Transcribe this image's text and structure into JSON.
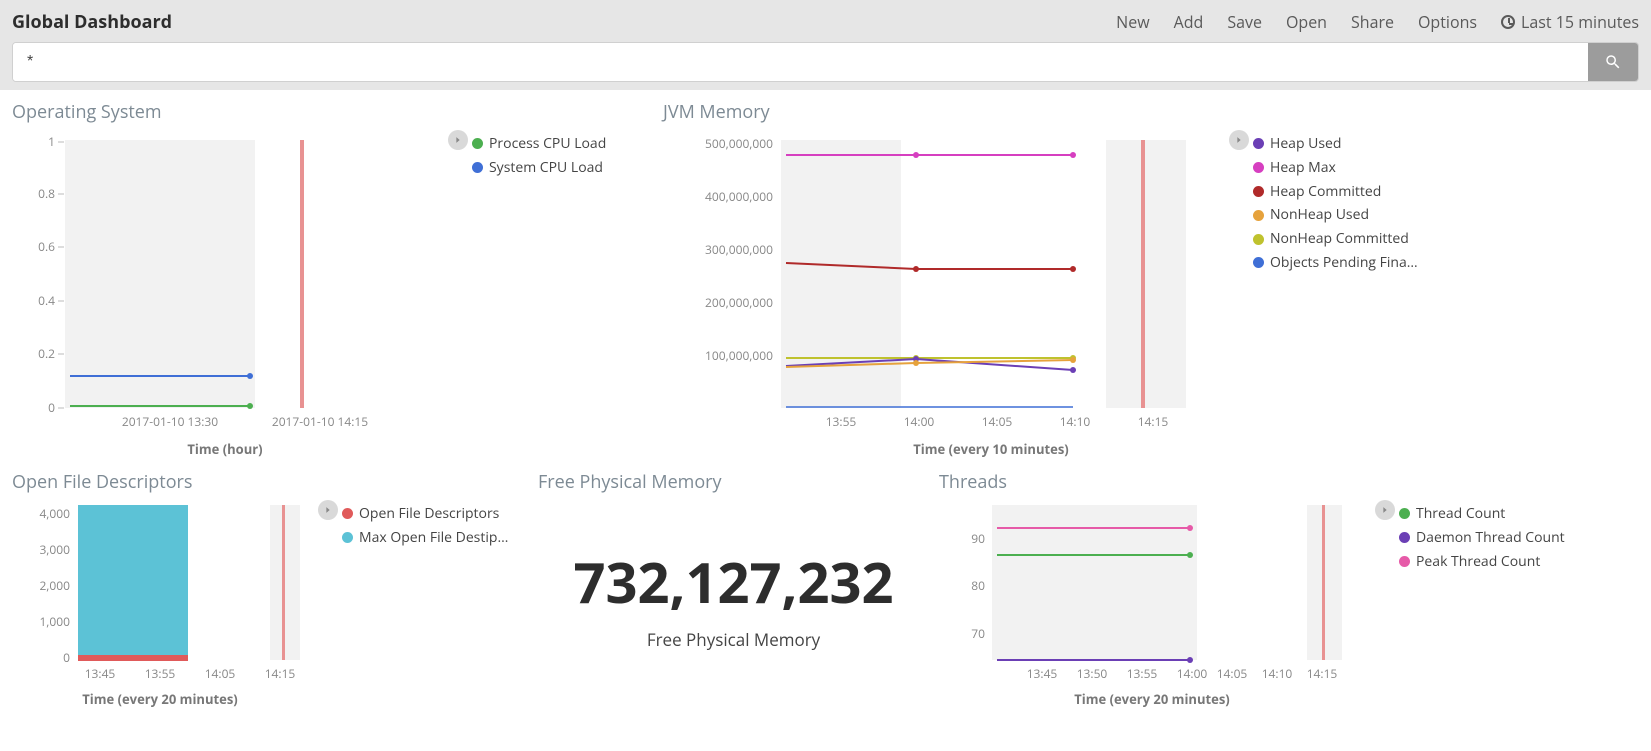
{
  "header": {
    "title": "Global Dashboard",
    "menu": {
      "new": "New",
      "add": "Add",
      "save": "Save",
      "open": "Open",
      "share": "Share",
      "options": "Options",
      "time_range": "Last 15 minutes"
    },
    "search_value": "*"
  },
  "colors": {
    "green": "#4caf50",
    "blue": "#3f6fd6",
    "purple": "#6b3fb5",
    "magenta": "#d63fc0",
    "darkred": "#b02a2a",
    "orange": "#e6a23c",
    "olive": "#bfc22e",
    "lightblue": "#5cc2d6",
    "red": "#e05a5a",
    "pink": "#e65aa8"
  },
  "panels": {
    "os": {
      "title": "Operating System",
      "xlabel": "Time (hour)",
      "legend": [
        {
          "color": "#4caf50",
          "label": "Process CPU Load"
        },
        {
          "color": "#3f6fd6",
          "label": "System CPU Load"
        }
      ]
    },
    "jvm": {
      "title": "JVM Memory",
      "xlabel": "Time (every 10 minutes)",
      "legend": [
        {
          "color": "#6b3fb5",
          "label": "Heap Used"
        },
        {
          "color": "#d63fc0",
          "label": "Heap Max"
        },
        {
          "color": "#b02a2a",
          "label": "Heap Committed"
        },
        {
          "color": "#e6a23c",
          "label": "NonHeap Used"
        },
        {
          "color": "#bfc22e",
          "label": "NonHeap Committed"
        },
        {
          "color": "#3f6fd6",
          "label": "Objects Pending Fina…"
        }
      ]
    },
    "ofd": {
      "title": "Open File Descriptors",
      "xlabel": "Time (every 20 minutes)",
      "legend": [
        {
          "color": "#e05a5a",
          "label": "Open File Descriptors"
        },
        {
          "color": "#5cc2d6",
          "label": "Max Open File Destip…"
        }
      ]
    },
    "freemem": {
      "title": "Free Physical Memory",
      "value": "732,127,232",
      "subtitle": "Free Physical Memory"
    },
    "threads": {
      "title": "Threads",
      "xlabel": "Time (every 20 minutes)",
      "legend": [
        {
          "color": "#4caf50",
          "label": "Thread Count"
        },
        {
          "color": "#6b3fb5",
          "label": "Daemon Thread Count"
        },
        {
          "color": "#e65aa8",
          "label": "Peak Thread Count"
        }
      ]
    }
  },
  "chart_data": [
    {
      "id": "os",
      "type": "line",
      "xlabel": "Time (hour)",
      "x_ticks": [
        "2017-01-10 13:30",
        "2017-01-10 14:15"
      ],
      "ylim": [
        0,
        1
      ],
      "y_ticks": [
        0,
        0.2,
        0.4,
        0.6,
        0.8,
        1
      ],
      "now_marker": "2017-01-10 14:15",
      "series": [
        {
          "name": "Process CPU Load",
          "color": "#4caf50",
          "x": [
            "13:30",
            "14:00"
          ],
          "y": [
            0.005,
            0.005
          ]
        },
        {
          "name": "System CPU Load",
          "color": "#3f6fd6",
          "x": [
            "13:30",
            "14:00"
          ],
          "y": [
            0.12,
            0.12
          ]
        }
      ]
    },
    {
      "id": "jvm",
      "type": "line",
      "xlabel": "Time (every 10 minutes)",
      "x_ticks": [
        "13:55",
        "14:00",
        "14:05",
        "14:10",
        "14:15"
      ],
      "ylim": [
        0,
        500000000
      ],
      "y_ticks": [
        100000000,
        200000000,
        300000000,
        400000000,
        500000000
      ],
      "y_tick_labels": [
        "100,000,000",
        "200,000,000",
        "300,000,000",
        "400,000,000",
        "500,000,000"
      ],
      "now_marker": "14:15",
      "series": [
        {
          "name": "Heap Max",
          "color": "#d63fc0",
          "x": [
            "13:52",
            "14:00",
            "14:10"
          ],
          "y": [
            477000000,
            477000000,
            477000000
          ]
        },
        {
          "name": "Heap Committed",
          "color": "#b02a2a",
          "x": [
            "13:52",
            "14:00",
            "14:10"
          ],
          "y": [
            272000000,
            261000000,
            261000000
          ]
        },
        {
          "name": "NonHeap Committed",
          "color": "#bfc22e",
          "x": [
            "13:52",
            "14:00",
            "14:10"
          ],
          "y": [
            95000000,
            95000000,
            95000000
          ]
        },
        {
          "name": "Heap Used",
          "color": "#6b3fb5",
          "x": [
            "13:52",
            "14:00",
            "14:10"
          ],
          "y": [
            82000000,
            92000000,
            73000000
          ]
        },
        {
          "name": "NonHeap Used",
          "color": "#e6a23c",
          "x": [
            "13:52",
            "14:00",
            "14:10"
          ],
          "y": [
            80000000,
            86000000,
            90000000
          ]
        },
        {
          "name": "Objects Pending Finalization",
          "color": "#3f6fd6",
          "x": [
            "13:52",
            "14:00",
            "14:10"
          ],
          "y": [
            0,
            0,
            0
          ]
        }
      ]
    },
    {
      "id": "ofd",
      "type": "bar",
      "xlabel": "Time (every 20 minutes)",
      "x_ticks": [
        "13:45",
        "13:55",
        "14:05",
        "14:15"
      ],
      "ylim": [
        0,
        4200
      ],
      "y_ticks": [
        0,
        1000,
        2000,
        3000,
        4000
      ],
      "y_tick_labels": [
        "0",
        "1,000",
        "2,000",
        "3,000",
        "4,000"
      ],
      "now_marker": "14:15",
      "stacked": true,
      "series": [
        {
          "name": "Open File Descriptors",
          "color": "#e05a5a",
          "x": [
            "13:45-13:55"
          ],
          "y": [
            150
          ]
        },
        {
          "name": "Max Open File Descriptors",
          "color": "#5cc2d6",
          "x": [
            "13:45-13:55"
          ],
          "y": [
            4096
          ]
        }
      ]
    },
    {
      "id": "threads",
      "type": "line",
      "xlabel": "Time (every 20 minutes)",
      "x_ticks": [
        "13:45",
        "13:50",
        "13:55",
        "14:00",
        "14:05",
        "14:10",
        "14:15"
      ],
      "ylim": [
        60,
        100
      ],
      "y_ticks": [
        70,
        80,
        90
      ],
      "now_marker": "14:15",
      "series": [
        {
          "name": "Peak Thread Count",
          "color": "#e65aa8",
          "x": [
            "13:42",
            "14:00"
          ],
          "y": [
            93,
            93
          ]
        },
        {
          "name": "Thread Count",
          "color": "#4caf50",
          "x": [
            "13:42",
            "14:00"
          ],
          "y": [
            87,
            87
          ]
        },
        {
          "name": "Daemon Thread Count",
          "color": "#6b3fb5",
          "x": [
            "13:42",
            "14:00"
          ],
          "y": [
            63,
            63
          ]
        }
      ]
    }
  ]
}
